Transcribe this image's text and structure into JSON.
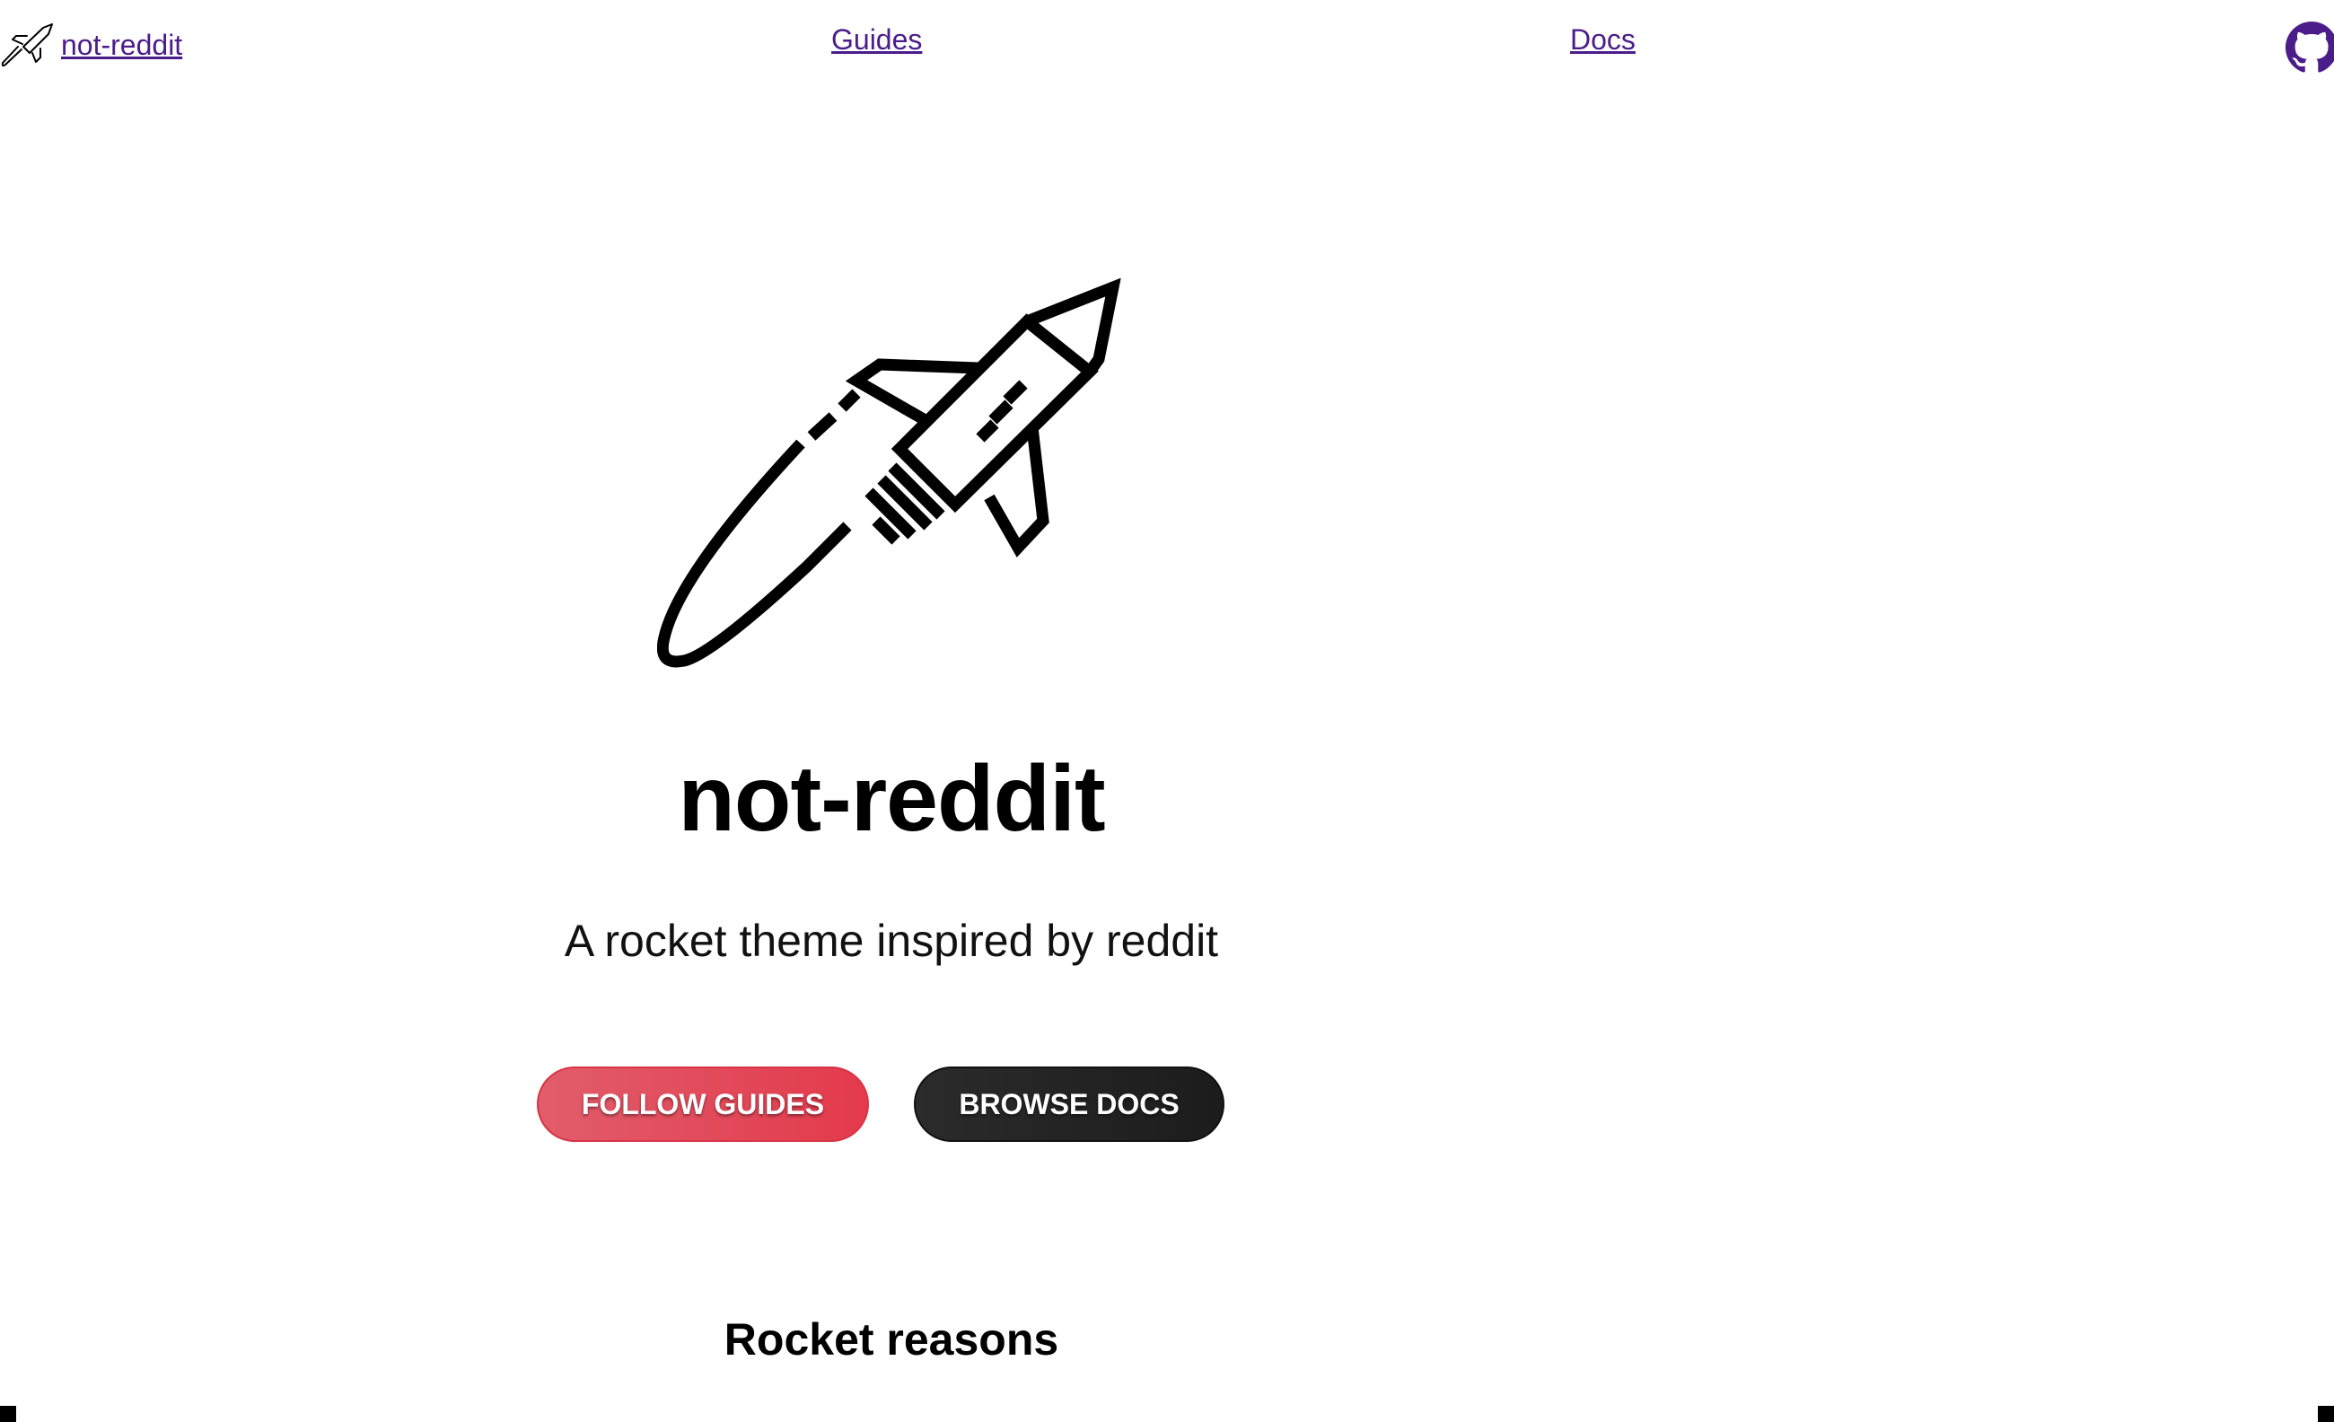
{
  "nav": {
    "brand_label": "not-reddit",
    "guides_label": "Guides",
    "docs_label": "Docs"
  },
  "hero": {
    "title": "not-reddit",
    "subtitle": "A rocket theme inspired by reddit"
  },
  "buttons": {
    "follow_guides": "FOLLOW GUIDES",
    "browse_docs": "BROWSE DOCS"
  },
  "section": {
    "heading": "Rocket reasons"
  },
  "icons": {
    "brand": "rocket-icon",
    "github": "github-icon",
    "hero": "rocket-icon"
  },
  "colors": {
    "link": "#4b1d8a",
    "primary_button": "#e33a4c",
    "secondary_button": "#1f1f1f"
  }
}
